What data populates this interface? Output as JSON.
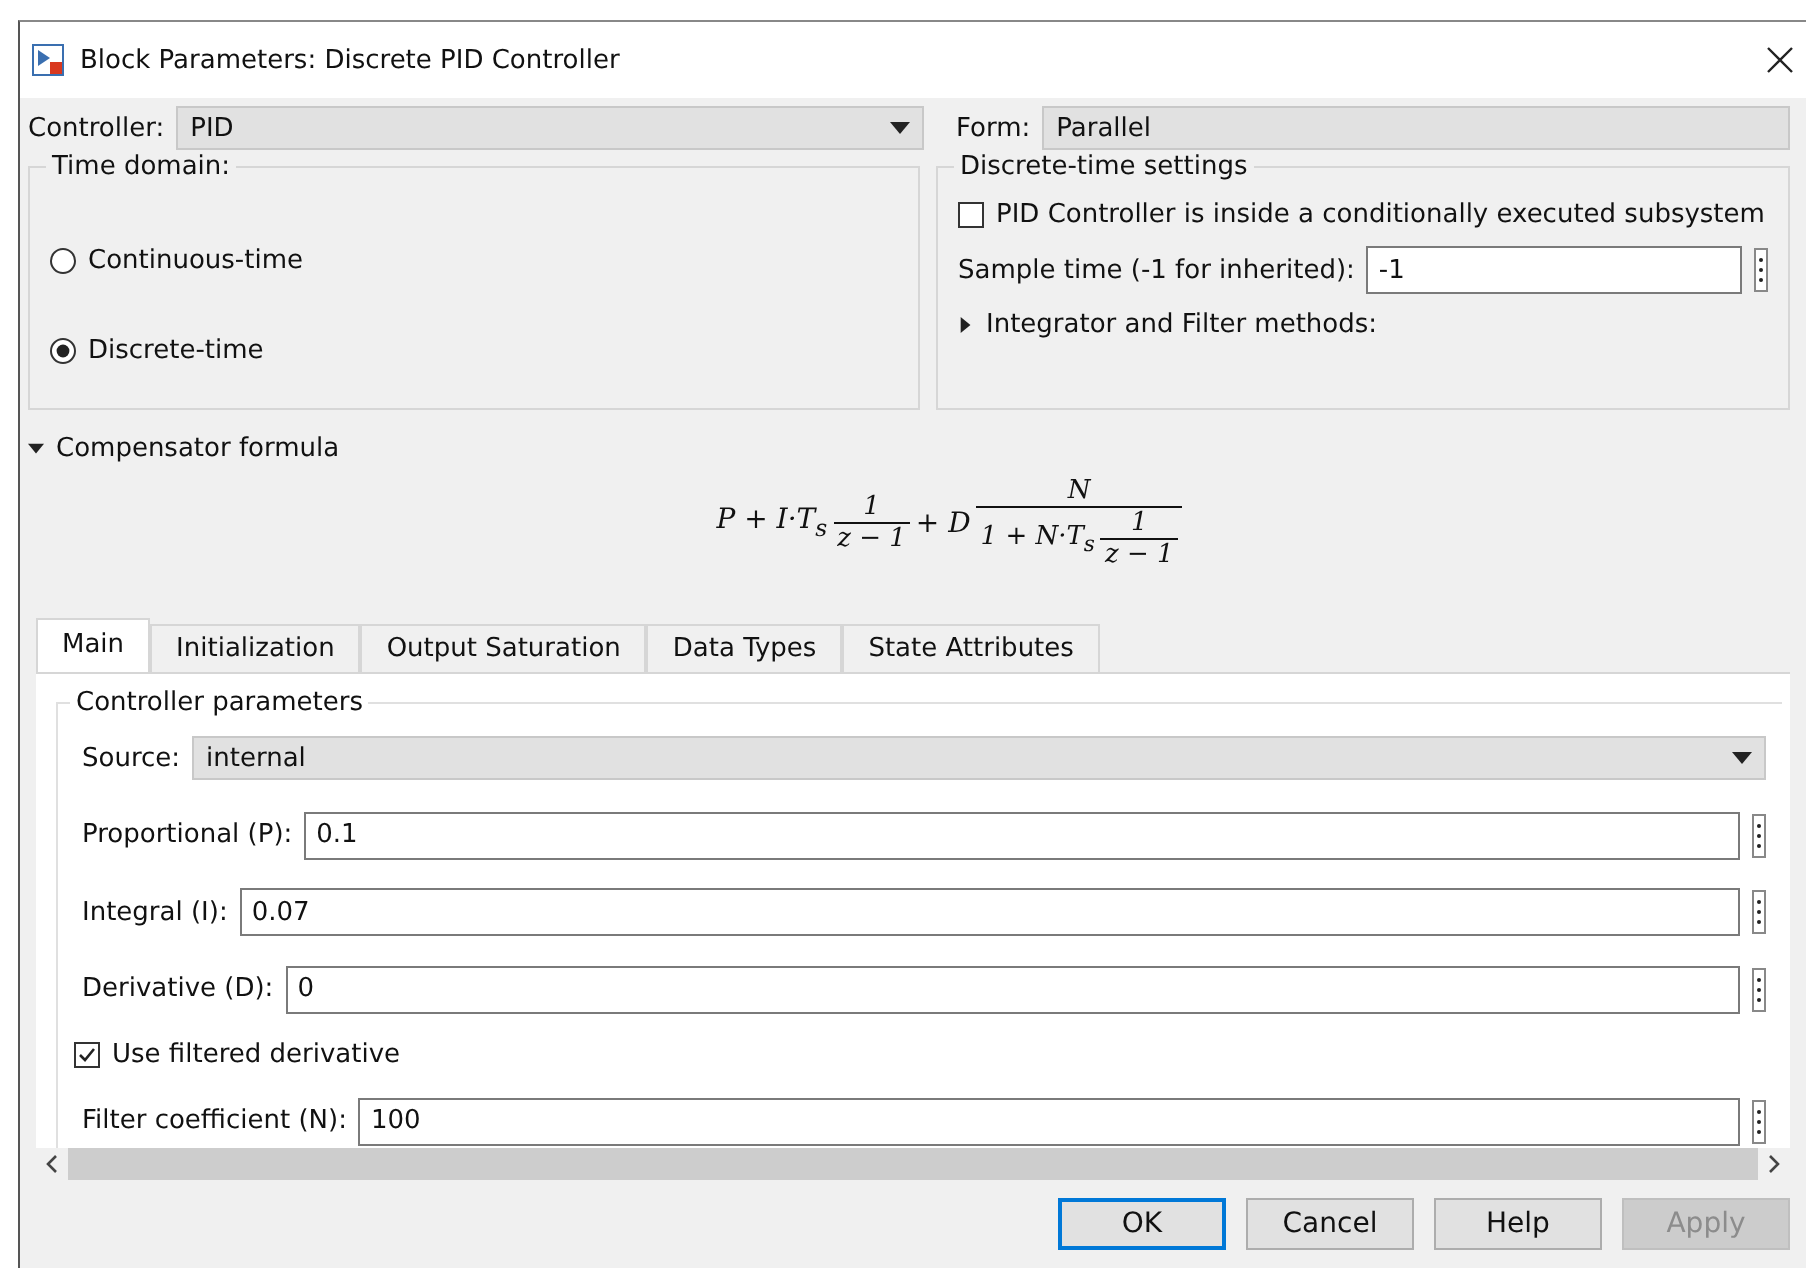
{
  "window": {
    "title": "Block Parameters: Discrete PID Controller"
  },
  "controller": {
    "label": "Controller:",
    "value": "PID"
  },
  "form": {
    "label": "Form:",
    "value": "Parallel"
  },
  "time_domain": {
    "title": "Time domain:",
    "options": [
      {
        "label": "Continuous-time",
        "selected": false
      },
      {
        "label": "Discrete-time",
        "selected": true
      }
    ]
  },
  "discrete_settings": {
    "title": "Discrete-time settings",
    "conditional": {
      "label": "PID Controller is inside a conditionally executed subsystem",
      "checked": false
    },
    "sample_time": {
      "label": "Sample time (-1 for inherited):",
      "value": "-1"
    },
    "methods": {
      "label": "Integrator and Filter methods:",
      "expanded": false
    }
  },
  "compensator": {
    "label": "Compensator formula",
    "expanded": true,
    "formula": {
      "lead": "P + I·T$_{s}$",
      "frac1": {
        "num": "1",
        "den": "z − 1"
      },
      "mid": "+ D",
      "frac2": {
        "num": "N",
        "den_lead": "1 + N·T$_{s}$",
        "den_frac": {
          "num": "1",
          "den": "z − 1"
        }
      }
    }
  },
  "tabs": [
    {
      "label": "Main",
      "selected": true
    },
    {
      "label": "Initialization",
      "selected": false
    },
    {
      "label": "Output Saturation",
      "selected": false
    },
    {
      "label": "Data Types",
      "selected": false
    },
    {
      "label": "State Attributes",
      "selected": false
    }
  ],
  "parameters": {
    "title": "Controller parameters",
    "rows": [
      {
        "kind": "dropdown",
        "label": "Source:",
        "value": "internal"
      },
      {
        "kind": "field",
        "label": "Proportional (P):",
        "value": "0.1"
      },
      {
        "kind": "field",
        "label": "Integral (I):",
        "value": "0.07"
      },
      {
        "kind": "field",
        "label": "Derivative (D):",
        "value": "0"
      },
      {
        "kind": "checkbox",
        "label": "Use filtered derivative",
        "checked": true
      },
      {
        "kind": "field",
        "label": "Filter coefficient (N):",
        "value": "100"
      }
    ]
  },
  "buttons": [
    {
      "label": "OK",
      "default": true,
      "disabled": false
    },
    {
      "label": "Cancel",
      "default": false,
      "disabled": false
    },
    {
      "label": "Help",
      "default": false,
      "disabled": false
    },
    {
      "label": "Apply",
      "default": false,
      "disabled": true
    }
  ]
}
